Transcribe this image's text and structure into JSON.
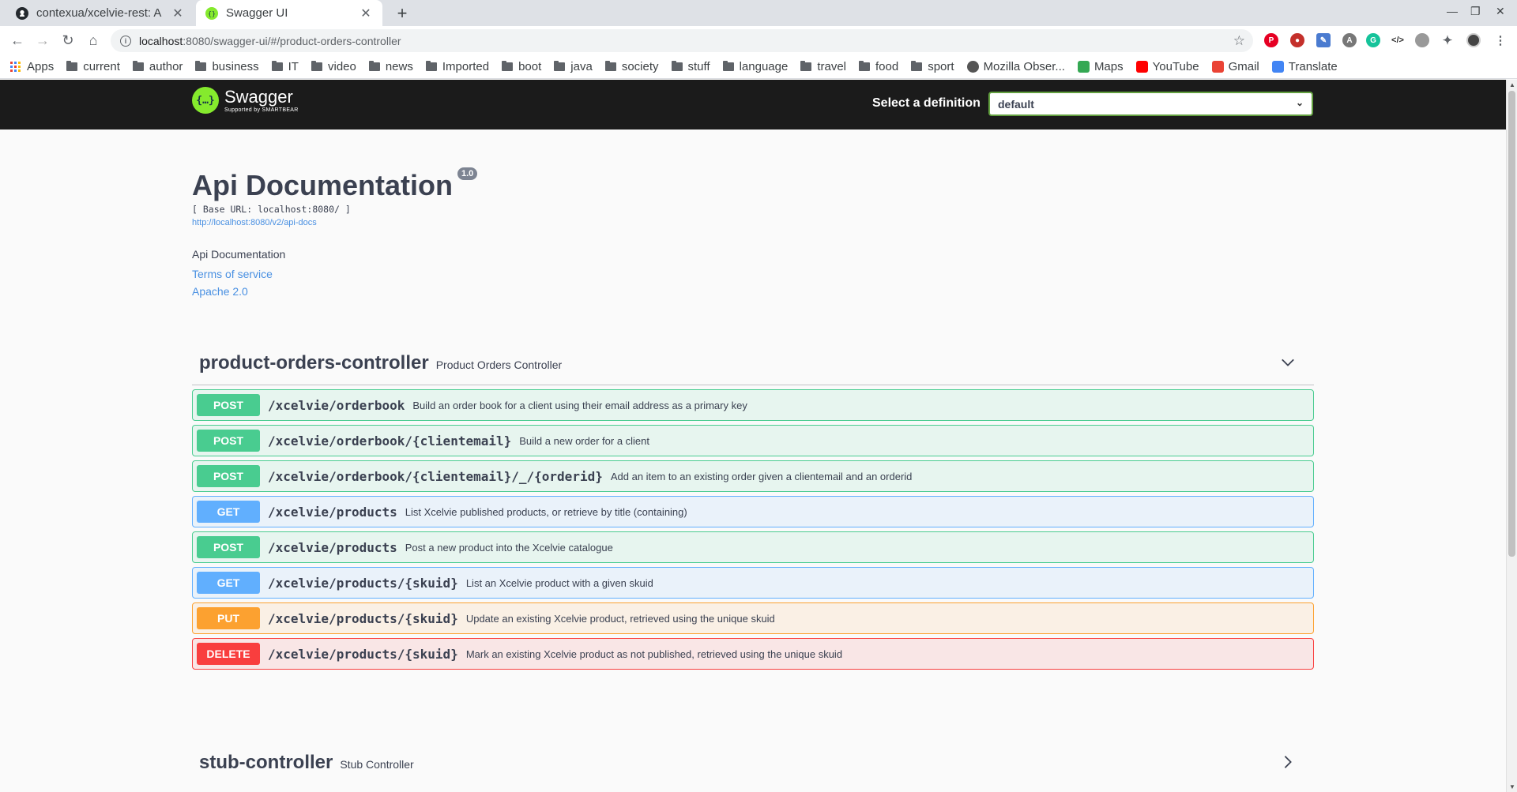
{
  "browser": {
    "tabs": [
      {
        "title": "contexua/xcelvie-rest: A m",
        "icon": "github-icon"
      },
      {
        "title": "Swagger UI",
        "icon": "swagger-icon"
      }
    ],
    "new_tab_label": "+",
    "url_host": "localhost",
    "url_path": ":8080/swagger-ui/#/product-orders-controller",
    "bookmarks": [
      {
        "label": "Apps",
        "icon": "apps-icon"
      },
      {
        "label": "current",
        "icon": "folder-icon"
      },
      {
        "label": "author",
        "icon": "folder-icon"
      },
      {
        "label": "business",
        "icon": "folder-icon"
      },
      {
        "label": "IT",
        "icon": "folder-icon"
      },
      {
        "label": "video",
        "icon": "folder-icon"
      },
      {
        "label": "news",
        "icon": "folder-icon"
      },
      {
        "label": "Imported",
        "icon": "folder-icon"
      },
      {
        "label": "boot",
        "icon": "folder-icon"
      },
      {
        "label": "java",
        "icon": "folder-icon"
      },
      {
        "label": "society",
        "icon": "folder-icon"
      },
      {
        "label": "stuff",
        "icon": "folder-icon"
      },
      {
        "label": "language",
        "icon": "folder-icon"
      },
      {
        "label": "travel",
        "icon": "folder-icon"
      },
      {
        "label": "food",
        "icon": "folder-icon"
      },
      {
        "label": "sport",
        "icon": "folder-icon"
      },
      {
        "label": "Mozilla Obser...",
        "icon": "mozilla-icon"
      },
      {
        "label": "Maps",
        "icon": "maps-icon"
      },
      {
        "label": "YouTube",
        "icon": "youtube-icon"
      },
      {
        "label": "Gmail",
        "icon": "gmail-icon"
      },
      {
        "label": "Translate",
        "icon": "translate-icon"
      }
    ]
  },
  "swagger": {
    "logo_name": "Swagger",
    "logo_sub": "Supported by SMARTBEAR",
    "definition_label": "Select a definition",
    "definition_value": "default",
    "info": {
      "title": "Api Documentation",
      "version": "1.0",
      "base_url": "[ Base URL: localhost:8080/ ]",
      "api_docs_link": "http://localhost:8080/v2/api-docs",
      "description": "Api Documentation",
      "terms": "Terms of service",
      "license": "Apache 2.0"
    },
    "tags": [
      {
        "name": "product-orders-controller",
        "description": "Product Orders Controller",
        "expanded": true,
        "operations": [
          {
            "method": "POST",
            "path": "/xcelvie/orderbook",
            "summary": "Build an order book for a client using their email address as a primary key"
          },
          {
            "method": "POST",
            "path": "/xcelvie/orderbook/{clientemail}",
            "summary": "Build a new order for a client"
          },
          {
            "method": "POST",
            "path": "/xcelvie/orderbook/{clientemail}/_/{orderid}",
            "summary": "Add an item to an existing order given a clientemail and an orderid"
          },
          {
            "method": "GET",
            "path": "/xcelvie/products",
            "summary": "List Xcelvie published products, or retrieve by title (containing)"
          },
          {
            "method": "POST",
            "path": "/xcelvie/products",
            "summary": "Post a new product into the Xcelvie catalogue"
          },
          {
            "method": "GET",
            "path": "/xcelvie/products/{skuid}",
            "summary": "List an Xcelvie product with a given skuid"
          },
          {
            "method": "PUT",
            "path": "/xcelvie/products/{skuid}",
            "summary": "Update an existing Xcelvie product, retrieved using the unique skuid"
          },
          {
            "method": "DELETE",
            "path": "/xcelvie/products/{skuid}",
            "summary": "Mark an existing Xcelvie product as not published, retrieved using the unique skuid"
          }
        ]
      },
      {
        "name": "stub-controller",
        "description": "Stub Controller",
        "expanded": false,
        "operations": []
      }
    ]
  }
}
